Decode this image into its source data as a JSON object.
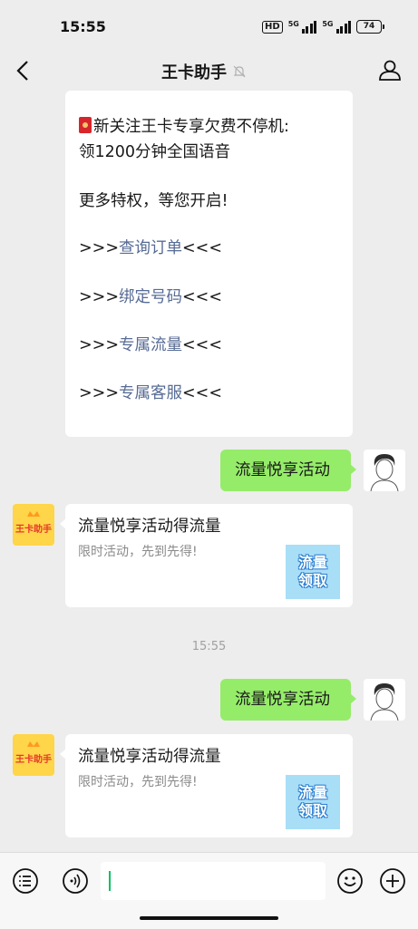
{
  "status_bar": {
    "time": "15:55",
    "hd": "HD",
    "signal1_label": "5G",
    "signal2_label": "5G",
    "battery": "74"
  },
  "nav": {
    "title": "王卡助手",
    "back_icon": "chevron-left-icon",
    "mute_icon": "bell-muted-icon",
    "profile_icon": "person-icon"
  },
  "messages": {
    "first_bubble": {
      "line1": "新关注王卡专享欠费不停机:",
      "line2": "领1200分钟全国语音",
      "line3": "更多特权，等您开启!",
      "items": [
        {
          "prefix": ">>>",
          "label": "查询订单",
          "suffix": "<<<"
        },
        {
          "prefix": ">>>",
          "label": "绑定号码",
          "suffix": "<<<"
        },
        {
          "prefix": ">>>",
          "label": "专属流量",
          "suffix": "<<<"
        },
        {
          "prefix": ">>>",
          "label": "专属客服",
          "suffix": "<<<"
        }
      ]
    },
    "user_msg_1": "流量悦享活动",
    "card_1": {
      "title": "流量悦享活动得流量",
      "desc": "限时活动，先到先得!",
      "thumb_line1": "流量",
      "thumb_line2": "领取"
    },
    "timestamp": "15:55",
    "user_msg_2": "流量悦享活动",
    "card_2": {
      "title": "流量悦享活动得流量",
      "desc": "限时活动，先到先得!",
      "thumb_line1": "流量",
      "thumb_line2": "领取"
    }
  },
  "bot_avatar_text": "王卡助手",
  "input_bar": {
    "list_icon": "menu-list-icon",
    "voice_icon": "voice-icon",
    "emoji_icon": "emoji-icon",
    "plus_icon": "plus-icon",
    "input_value": ""
  },
  "colors": {
    "accent_green": "#95ec69",
    "link_blue": "#576b95",
    "background": "#ededed"
  }
}
